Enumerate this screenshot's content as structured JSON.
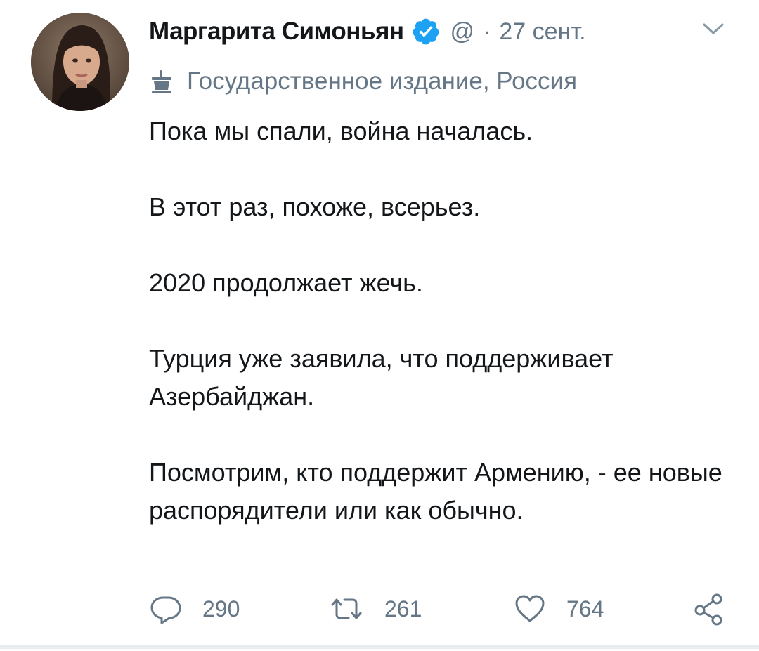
{
  "tweet": {
    "author": {
      "name": "Маргарита Симоньян",
      "handle": "@",
      "verified": true
    },
    "separator": "·",
    "date": "27 сент.",
    "label": {
      "icon": "state-media-podium-icon",
      "text": "Государственное издание, Россия"
    },
    "text_paragraphs": [
      "Пока мы спали, война началась.",
      "В этот раз, похоже, всерьез.",
      "2020 продолжает жечь.",
      "Турция уже заявила, что поддерживает Азербайджан.",
      "Посмотрим, кто поддержит Армению, - ее новые распорядители или как обычно."
    ],
    "actions": {
      "reply_count": "290",
      "retweet_count": "261",
      "like_count": "764"
    }
  },
  "colors": {
    "text_primary": "#14171a",
    "text_secondary": "#657786",
    "verified_blue": "#1da1f2",
    "divider": "#e6ecf0"
  }
}
